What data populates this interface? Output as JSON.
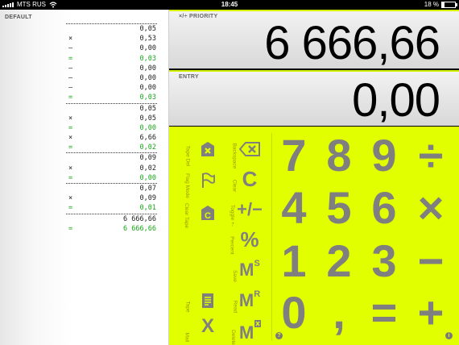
{
  "status_bar": {
    "carrier": "MTS RUS",
    "time": "18:45",
    "battery_text": "18 %",
    "battery_level": 0.18
  },
  "tape": {
    "title": "DEFAULT",
    "lines": [
      {
        "op": "",
        "value": "0,05",
        "kind": "sep"
      },
      {
        "op": "×",
        "value": "0,53",
        "kind": "normal"
      },
      {
        "op": "—",
        "value": "0,00",
        "kind": "normal"
      },
      {
        "op": "=",
        "value": "0,03",
        "kind": "res"
      },
      {
        "op": "—",
        "value": "0,00",
        "kind": "normal"
      },
      {
        "op": "—",
        "value": "0,00",
        "kind": "normal"
      },
      {
        "op": "—",
        "value": "0,00",
        "kind": "normal"
      },
      {
        "op": "=",
        "value": "0,03",
        "kind": "res"
      },
      {
        "op": "",
        "value": "0,05",
        "kind": "sep"
      },
      {
        "op": "×",
        "value": "0,05",
        "kind": "normal"
      },
      {
        "op": "=",
        "value": "0,00",
        "kind": "res"
      },
      {
        "op": "×",
        "value": "6,66",
        "kind": "normal"
      },
      {
        "op": "=",
        "value": "0,02",
        "kind": "res"
      },
      {
        "op": "",
        "value": "0,09",
        "kind": "sep"
      },
      {
        "op": "×",
        "value": "0,02",
        "kind": "normal"
      },
      {
        "op": "=",
        "value": "0,00",
        "kind": "res"
      },
      {
        "op": "",
        "value": "0,07",
        "kind": "sep"
      },
      {
        "op": "×",
        "value": "0,09",
        "kind": "normal"
      },
      {
        "op": "=",
        "value": "0,01",
        "kind": "res"
      },
      {
        "op": "",
        "value": "6 666,66",
        "kind": "sep"
      },
      {
        "op": "=",
        "value": "6 666,66",
        "kind": "res"
      }
    ]
  },
  "displays": {
    "priority": {
      "label": "×/÷ PRIORITY",
      "value": "6 666,66"
    },
    "entry": {
      "label": "ENTRY",
      "value": "0,00"
    }
  },
  "function_labels": {
    "tape_del": "Tape Del",
    "flag_mode": "Flag Mode",
    "clear_tape": "Clear Tape",
    "tape": "Tape",
    "mail": "Mail",
    "backspace": "Backspace",
    "clear": "Clear",
    "toggle": "Toggle +-",
    "percent": "Percent",
    "save": "Save",
    "read": "Read",
    "delete": "Delete"
  },
  "function_keys": {
    "clear_glyph": "C",
    "toggle_glyph": "+/−",
    "percent_glyph": "%",
    "memory_save_glyph": "M",
    "memory_save_sup": "S",
    "memory_read_glyph": "M",
    "memory_read_sup": "R",
    "mail_glyph": "X",
    "clear_tape_glyph": "C"
  },
  "digits": {
    "d7": "7",
    "d8": "8",
    "d9": "9",
    "divide": "÷",
    "d4": "4",
    "d5": "5",
    "d6": "6",
    "multiply": "×",
    "d1": "1",
    "d2": "2",
    "d3": "3",
    "minus": "−",
    "d0": "0",
    "comma": ",",
    "equals": "=",
    "plus": "+"
  },
  "help_glyph": "?",
  "info_glyph": "i",
  "colors": {
    "keypad_bg": "#e2ff00",
    "key_gray": "#7f7f7f",
    "result_green": "#1aa61a",
    "label_olive": "#9a9a00"
  },
  "icons": [
    "wifi-icon",
    "battery-icon",
    "tape-delete-icon",
    "flag-icon",
    "clear-tape-icon",
    "backspace-icon",
    "memory-delete-icon",
    "tape-export-icon",
    "help-icon",
    "info-icon"
  ]
}
